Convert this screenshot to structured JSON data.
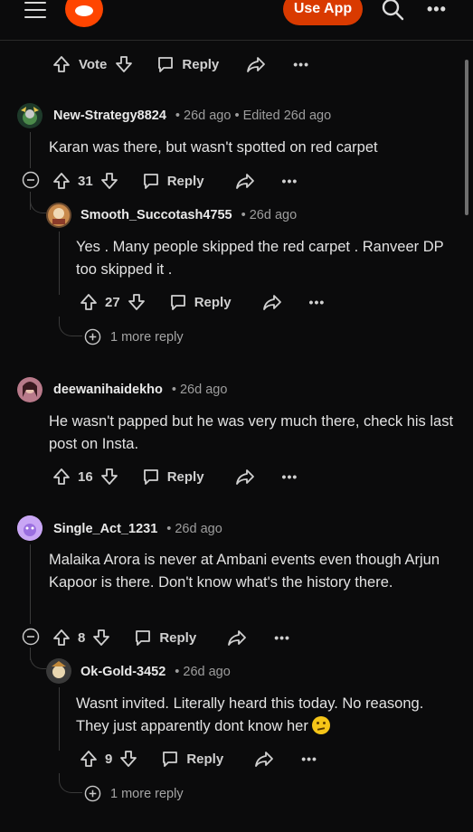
{
  "header": {
    "use_app_label": "Use App"
  },
  "top_actions": {
    "vote_label": "Vote",
    "reply_label": "Reply"
  },
  "comments": [
    {
      "username": "New-Strategy8824",
      "meta": "• 26d ago • Edited 26d ago",
      "body": "Karan was there, but wasn't spotted on red carpet",
      "votes": "31",
      "reply_label": "Reply",
      "replies": [
        {
          "username": "Smooth_Succotash4755",
          "meta": "• 26d ago",
          "body": "Yes . Many people skipped the red carpet . Ranveer DP too skipped it .",
          "votes": "27",
          "reply_label": "Reply",
          "more_replies": "1 more reply"
        }
      ]
    },
    {
      "username": "deewanihaidekho",
      "meta": "• 26d ago",
      "body": "He wasn't papped but he was very much there, check his last post on Insta.",
      "votes": "16",
      "reply_label": "Reply"
    },
    {
      "username": "Single_Act_1231",
      "meta": "• 26d ago",
      "body": "Malaika Arora is never at Ambani events even though Arjun Kapoor is there. Don't know what's the history there.",
      "votes": "8",
      "reply_label": "Reply",
      "replies": [
        {
          "username": "Ok-Gold-3452",
          "meta": "• 26d ago",
          "body": "Wasnt invited. Literally heard this today. No reasong. They just apparently dont know her",
          "votes": "9",
          "reply_label": "Reply",
          "more_replies": "1 more reply"
        }
      ]
    }
  ],
  "colors": {
    "accent": "#d93a00",
    "background": "#0b0b0c",
    "text": "#e2e2e2",
    "muted": "#9d9d9d"
  }
}
